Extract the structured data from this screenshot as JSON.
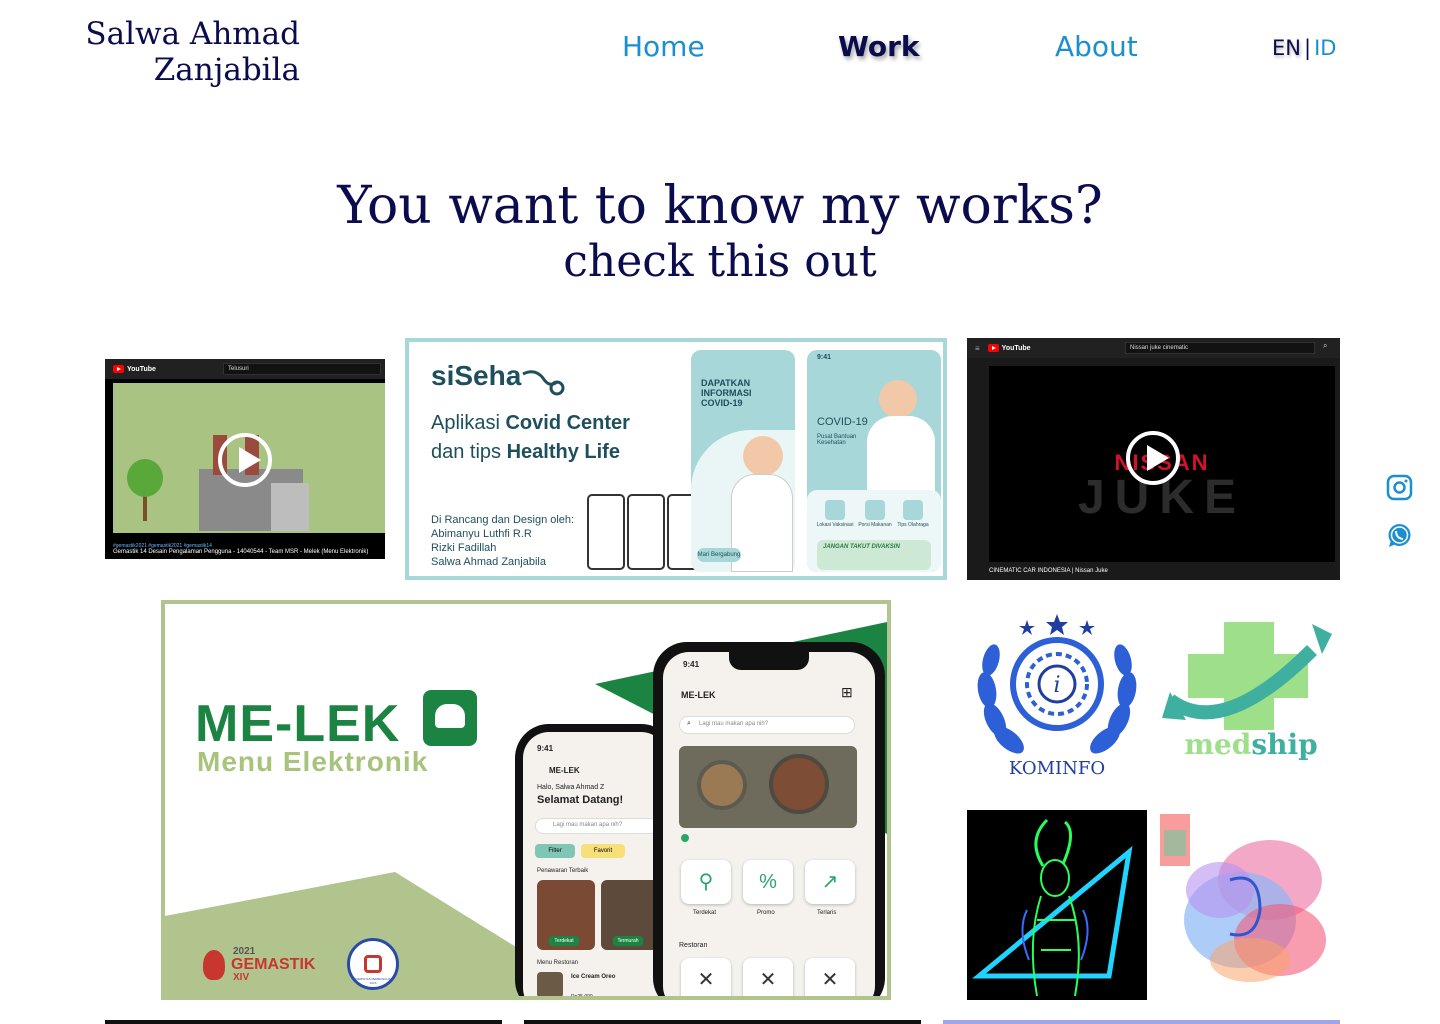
{
  "header": {
    "name_line1": "Salwa Ahmad",
    "name_line2": "Zanjabila",
    "nav": [
      {
        "label": "Home",
        "active": false
      },
      {
        "label": "Work",
        "active": true
      },
      {
        "label": "About",
        "active": false
      }
    ],
    "lang_en": "EN",
    "lang_sep": "|",
    "lang_id": "ID"
  },
  "hero": {
    "title": "You want to know my works?",
    "subtitle": "check this out"
  },
  "works": {
    "video_gemastik": {
      "search": "Telusuri",
      "caption_top": "#gemastik2021 #gemastik2021 #gemastik14",
      "caption": "Gemastik 14 Desain Pengalaman Pengguna - 14040544 - Team MSR - Melek (Menu Elektronik)"
    },
    "siseh": {
      "brand": "siSeha",
      "line1_pre": "Aplikasi ",
      "line1_bold": "Covid Center",
      "line2_pre": "dan tips ",
      "line2_bold": "Healthy Life",
      "credit_title": "Di Rancang dan Design oleh:",
      "credits": [
        "Abimanyu Luthfi R.R",
        "Rizki Fadillah",
        "Salwa Ahmad Zanjabila"
      ],
      "panel1": "DAPATKAN INFORMASI COVID-19",
      "panel2_time": "9:41",
      "panel2_title": "COVID-19",
      "panel2_sub": "Pusat Bantuan Kesehatan",
      "cta": "Mari Bergabung",
      "icons": [
        "Lokasi Vaksinasi",
        "Porsi Makanan",
        "Tips Olahraga"
      ],
      "banner": "JANGAN TAKUT DIVAKSIN"
    },
    "video_nissan": {
      "search": "Nissan juke cinematic",
      "brand_text": "NISSAN",
      "model_text": "JUKE",
      "caption": "CINEMATIC CAR INDONESIA | Nissan Juke"
    },
    "melek": {
      "title": "ME-LEK",
      "subtitle": "Menu Elektronik",
      "time": "9:41",
      "app_name": "ME-LEK",
      "search_placeholder": "Lagi mau makan apa nih?",
      "greeting_small": "Halo, Salwa Ahmad Z",
      "greeting": "Selamat Datang!",
      "chips": [
        "Filter",
        "Favorit"
      ],
      "section_offers": "Penawaran Terbaik",
      "offer_tags": [
        "Terdekat",
        "Termurah"
      ],
      "section_restaurant": "Menu Restoran",
      "menu_item": "Ice Cream Oreo",
      "menu_price": "Rp25.000",
      "categories": [
        "Terdekat",
        "Promo",
        "Terlaris"
      ],
      "section_restoran": "Restoran",
      "badge_year": "2021",
      "badge_name": "GEMASTIK",
      "badge_num": "XIV",
      "univ": "UNIVERSITAS PEMBANGUNAN JAYA"
    },
    "kominfo": {
      "label": "KOMINFO"
    },
    "medship": {
      "label_med": "med",
      "label_ship": "ship"
    }
  },
  "colors": {
    "navy": "#0b0c4d",
    "link_blue": "#1b8fd0",
    "melek_green": "#1c8443",
    "melek_light": "#a8c47c",
    "siseh_border": "#a7d7d8"
  },
  "social": [
    {
      "icon": "instagram-icon"
    },
    {
      "icon": "whatsapp-icon"
    }
  ]
}
